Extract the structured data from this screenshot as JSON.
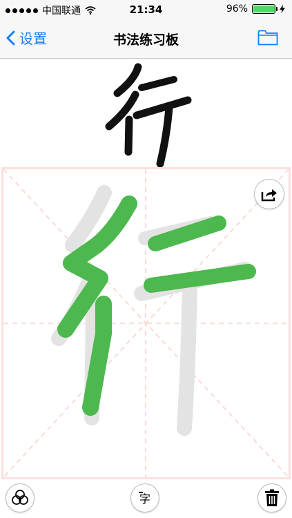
{
  "status_bar": {
    "carrier": "中国联通",
    "time": "21:34",
    "battery_percent": "96%",
    "battery_level": 0.96,
    "signal_bars": 5,
    "wifi_icon": "wifi-icon",
    "charging_icon": "charging-bolt-icon"
  },
  "nav": {
    "back_label": "设置",
    "title": "书法练习板",
    "folder_icon": "folder-icon"
  },
  "model_character": "行",
  "practice": {
    "trace_character": "行",
    "grid_style": "米字格",
    "grid_color": "#fcd0cc",
    "brush_color": "#4cb84e",
    "share_icon": "share-icon"
  },
  "toolbar": {
    "brush_icon": "brush-style-icon",
    "char_button_label": "字",
    "trash_icon": "trash-icon"
  },
  "colors": {
    "accent": "#157efb",
    "battery_green": "#4cd964"
  }
}
